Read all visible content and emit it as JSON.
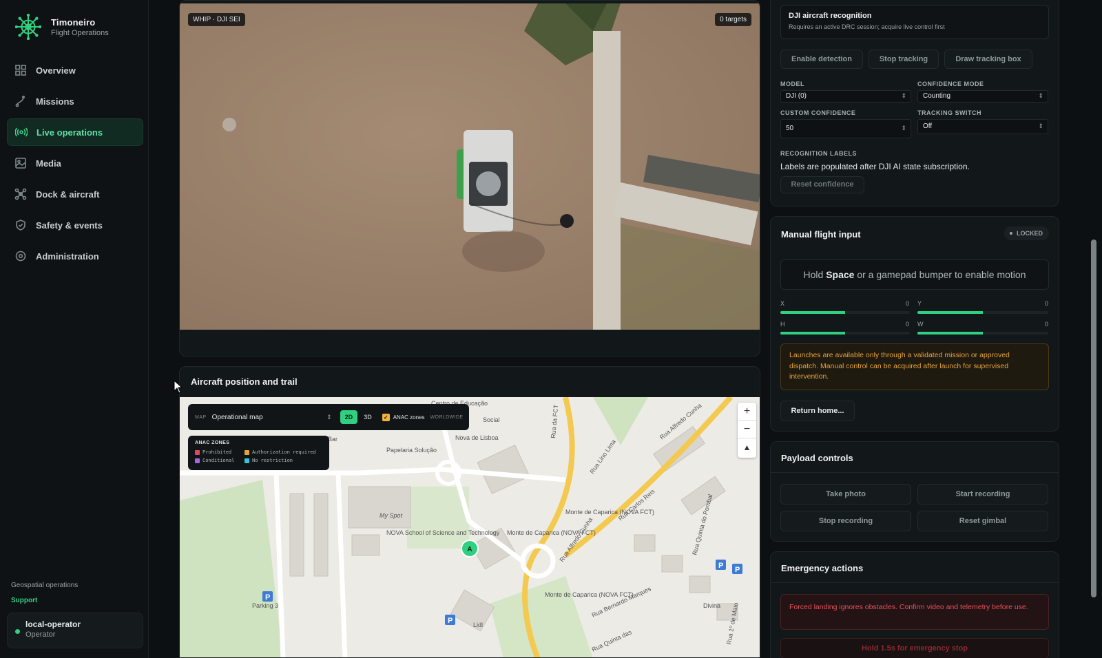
{
  "brand": {
    "name": "Timoneiro",
    "subtitle": "Flight Operations"
  },
  "nav": [
    {
      "label": "Overview",
      "icon": "grid-icon",
      "active": false
    },
    {
      "label": "Missions",
      "icon": "route-icon",
      "active": false
    },
    {
      "label": "Live operations",
      "icon": "broadcast-icon",
      "active": true
    },
    {
      "label": "Media",
      "icon": "image-icon",
      "active": false
    },
    {
      "label": "Dock & aircraft",
      "icon": "drone-icon",
      "active": false
    },
    {
      "label": "Safety & events",
      "icon": "shield-icon",
      "active": false
    },
    {
      "label": "Administration",
      "icon": "gear-icon",
      "active": false
    }
  ],
  "footer": {
    "geospatial": "Geospatial operations",
    "support": "Support"
  },
  "user": {
    "name": "local-operator",
    "role": "Operator",
    "status_color": "#2fd07f"
  },
  "video": {
    "stream_label": "WHIP · DJI SEI",
    "targets": "0 targets"
  },
  "map_panel": {
    "title": "Aircraft position and trail",
    "map_label": "MAP",
    "map_select": "Operational map",
    "mode_2d": "2D",
    "mode_3d": "3D",
    "anac_label": "ANAC zones",
    "worldwide": "WORLDWIDE",
    "legend_title": "ANAC ZONES",
    "legend": [
      {
        "label": "Prohibited",
        "color": "#e0475d"
      },
      {
        "label": "Authorization required",
        "color": "#e6a23c"
      },
      {
        "label": "Conditional",
        "color": "#a667e6"
      },
      {
        "label": "No restriction",
        "color": "#34c6d8"
      }
    ],
    "zoom_in": "+",
    "zoom_out": "−",
    "compass": "▲",
    "aircraft_marker": "A",
    "places": {
      "nova": "NOVA School of Science and Technology",
      "myspot": "My Spot",
      "papelaria": "Papelaria Solução",
      "centro": "Centro de Educação",
      "social": "Social",
      "novalisboa": "Nova de Lisboa",
      "bar": "Bar",
      "parking3": "Parking 3",
      "lidl": "Lidl",
      "rua_lino_lima": "Rua Lino Lima",
      "rua_alfredo_cunha": "Rua Alfredo Cunha",
      "rua_alfredo_cunha2": "Rua Alfredo Cunha",
      "rua_carlos_reis": "Rua Carlos Reis",
      "rua_da_fct": "Rua da FCT",
      "monte1": "Monte de Caparica (NOVA FCT)",
      "monte2": "Monte de Caparica (NOVA FCT)",
      "monte3": "Monte de Caparica (NOVA FCT)",
      "rua_quinta": "Rua Quinta das",
      "rua_bernardo": "Rua Bernardo Marques",
      "rua_pombal": "Rua Quinta do Pombal",
      "divina": "Divina",
      "rua_maio": "Rua 1º de Maio"
    }
  },
  "recognition": {
    "title": "DJI aircraft recognition",
    "subtitle": "Requires an active DRC session; acquire live control first",
    "enable": "Enable detection",
    "stop": "Stop tracking",
    "draw": "Draw tracking box",
    "model_label": "MODEL",
    "model_value": "DJI (0)",
    "mode_label": "CONFIDENCE MODE",
    "mode_value": "Counting",
    "custom_label": "CUSTOM CONFIDENCE",
    "custom_value": "50",
    "switch_label": "TRACKING SWITCH",
    "switch_value": "Off",
    "labels_label": "RECOGNITION LABELS",
    "labels_text": "Labels are populated after DJI AI state subscription.",
    "reset": "Reset confidence"
  },
  "manual": {
    "title": "Manual flight input",
    "status": "LOCKED",
    "hint_pre": "Hold ",
    "hint_key": "Space",
    "hint_post": " or a gamepad bumper to enable motion",
    "axes": [
      {
        "name": "X",
        "value": "0",
        "fill": 0.5
      },
      {
        "name": "Y",
        "value": "0",
        "fill": 0.5
      },
      {
        "name": "H",
        "value": "0",
        "fill": 0.5
      },
      {
        "name": "W",
        "value": "0",
        "fill": 0.5
      }
    ],
    "warning": "Launches are available only through a validated mission or approved dispatch. Manual control can be acquired after launch for supervised intervention.",
    "return_home": "Return home..."
  },
  "payload": {
    "title": "Payload controls",
    "take_photo": "Take photo",
    "start_rec": "Start recording",
    "stop_rec": "Stop recording",
    "reset_gimbal": "Reset gimbal"
  },
  "emergency": {
    "title": "Emergency actions",
    "warning": "Forced landing ignores obstacles. Confirm video and telemetry before use.",
    "hold": "Hold 1.5s for emergency stop"
  },
  "colors": {
    "accent": "#2fd07f",
    "warning": "#e6a23c",
    "danger": "#e0475d"
  }
}
